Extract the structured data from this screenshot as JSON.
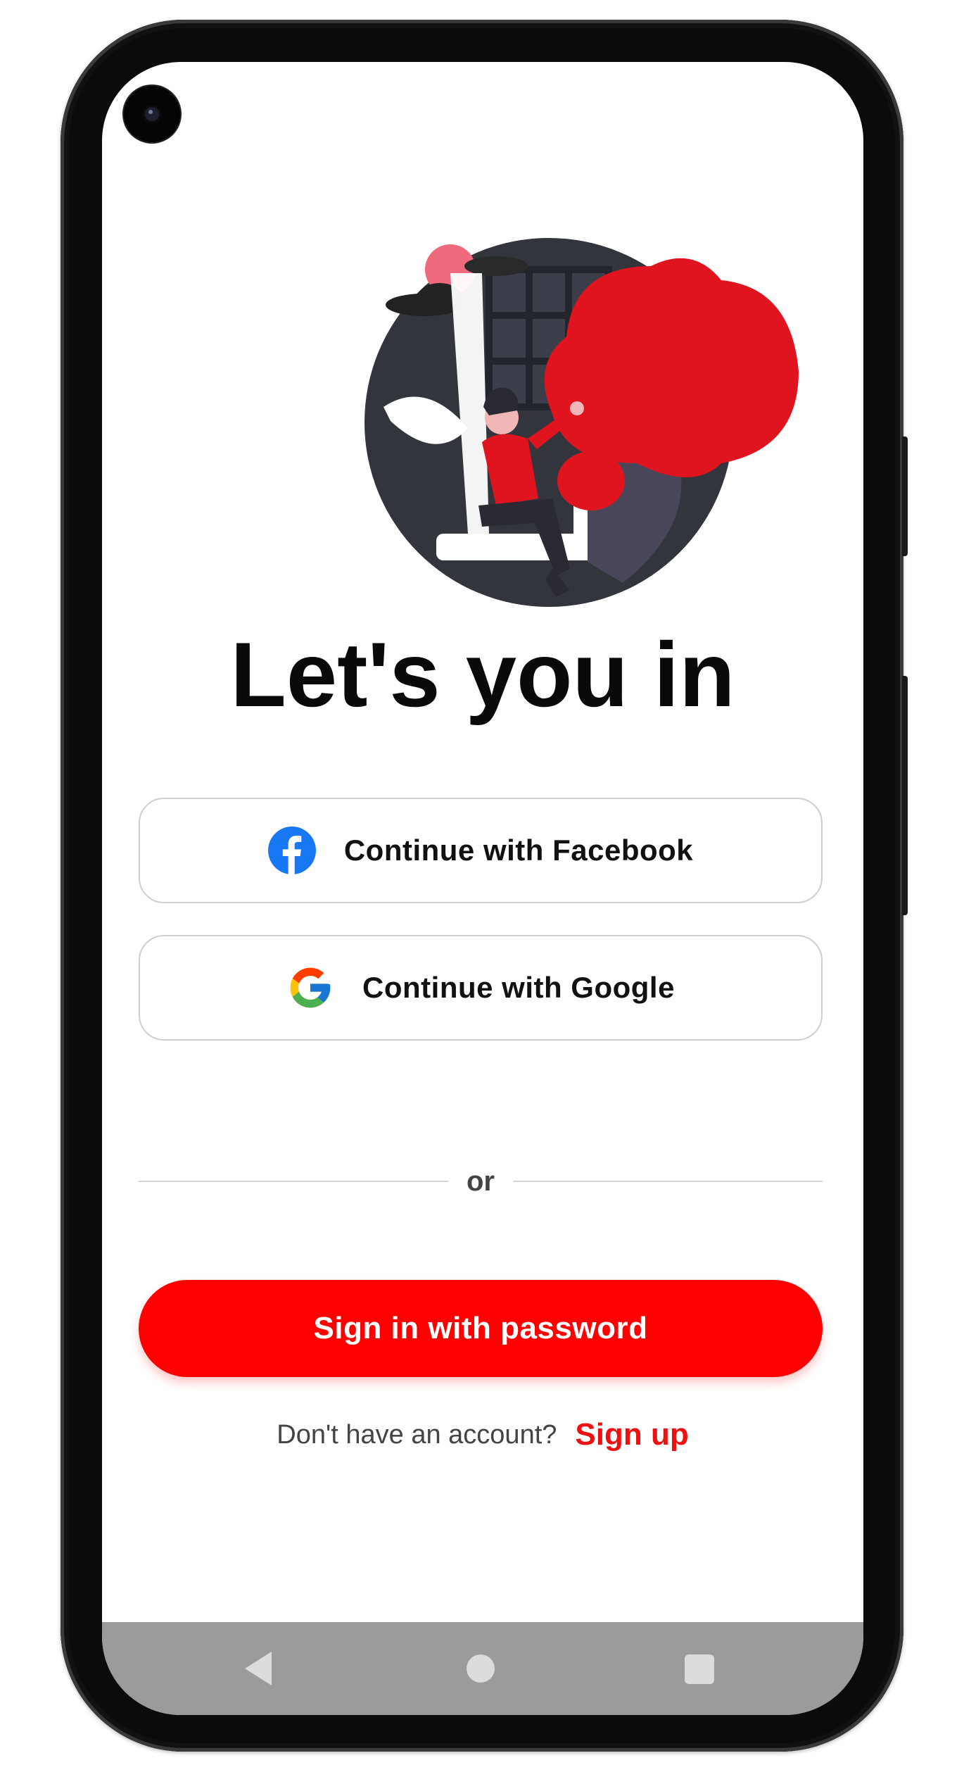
{
  "screen": {
    "title": "Let's you in"
  },
  "social": {
    "facebook_label": "Continue with Facebook",
    "facebook_icon": "facebook-icon",
    "google_label": "Continue with Google",
    "google_icon": "google-icon"
  },
  "divider": {
    "text": "or"
  },
  "primary": {
    "label": "Sign in with password"
  },
  "signup": {
    "prompt": "Don't have an account?",
    "link": "Sign up"
  },
  "nav": {
    "back_icon": "back-triangle-icon",
    "home_icon": "home-circle-icon",
    "recents_icon": "recents-square-icon"
  },
  "colors": {
    "accent": "#ff0000",
    "signup_link": "#ee1111",
    "facebook_blue": "#1877f2",
    "navbar": "#9b9b9b"
  }
}
